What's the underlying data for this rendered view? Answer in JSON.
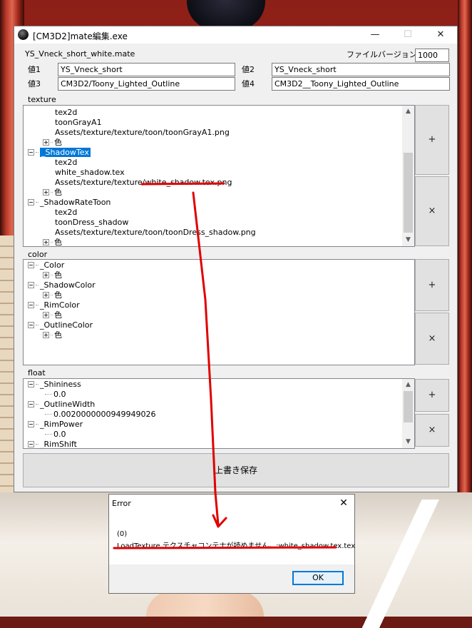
{
  "window": {
    "title": "[CM3D2]mate編集.exe",
    "minimize": "—",
    "maximize": "☐",
    "close": "✕"
  },
  "header": {
    "filename": "YS_Vneck_short_white.mate",
    "file_version_label": "ファイルバージョン",
    "file_version_value": "1000",
    "value1_label": "値1",
    "value1": "YS_Vneck_short",
    "value2_label": "値2",
    "value2": "YS_Vneck_short",
    "value3_label": "値3",
    "value3": "CM3D2/Toony_Lighted_Outline",
    "value4_label": "値4",
    "value4": "CM3D2__Toony_Lighted_Outline"
  },
  "texture": {
    "title": "texture",
    "rows": [
      {
        "text": "tex2d",
        "kind": "leaf"
      },
      {
        "text": "toonGrayA1",
        "kind": "leaf"
      },
      {
        "text": "Assets/texture/texture/toon/toonGrayA1.png",
        "kind": "leaf"
      },
      {
        "text": "色",
        "kind": "child-plus"
      },
      {
        "text": "_ShadowTex",
        "kind": "node",
        "selected": true
      },
      {
        "text": "tex2d",
        "kind": "leaf"
      },
      {
        "text": "white_shadow.tex",
        "kind": "leaf"
      },
      {
        "text": "Assets/texture/texture/white_shadow.tex.png",
        "kind": "leaf"
      },
      {
        "text": "色",
        "kind": "child-plus"
      },
      {
        "text": "_ShadowRateToon",
        "kind": "node"
      },
      {
        "text": "tex2d",
        "kind": "leaf"
      },
      {
        "text": "toonDress_shadow",
        "kind": "leaf"
      },
      {
        "text": "Assets/texture/texture/toon/toonDress_shadow.png",
        "kind": "leaf"
      },
      {
        "text": "色",
        "kind": "child-plus"
      }
    ],
    "add_label": "+",
    "remove_label": "×"
  },
  "color": {
    "title": "color",
    "rows": [
      {
        "text": "_Color",
        "kind": "node"
      },
      {
        "text": "色",
        "kind": "child-plus"
      },
      {
        "text": "_ShadowColor",
        "kind": "node"
      },
      {
        "text": "色",
        "kind": "child-plus"
      },
      {
        "text": "_RimColor",
        "kind": "node"
      },
      {
        "text": "色",
        "kind": "child-plus"
      },
      {
        "text": "_OutlineColor",
        "kind": "node"
      },
      {
        "text": "色",
        "kind": "child-plus"
      }
    ],
    "add_label": "+",
    "remove_label": "×"
  },
  "float": {
    "title": "float",
    "rows": [
      {
        "text": "_Shininess",
        "kind": "node"
      },
      {
        "text": "0.0",
        "kind": "value"
      },
      {
        "text": "_OutlineWidth",
        "kind": "node"
      },
      {
        "text": "0.0020000000949949026",
        "kind": "value"
      },
      {
        "text": "_RimPower",
        "kind": "node"
      },
      {
        "text": "0.0",
        "kind": "value"
      },
      {
        "text": "_RimShift",
        "kind": "node"
      }
    ],
    "add_label": "+",
    "remove_label": "×"
  },
  "save_label": "上書き保存",
  "error_dialog": {
    "title": "Error",
    "close": "✕",
    "line1": "(0)",
    "line2": "LoadTexture テクスチャコンテナが読めません。:white_shadow.tex.tex",
    "ok_label": "OK"
  },
  "colors": {
    "selection": "#0078d7",
    "annotation": "#e00000",
    "window_bg": "#f0f0f0"
  }
}
